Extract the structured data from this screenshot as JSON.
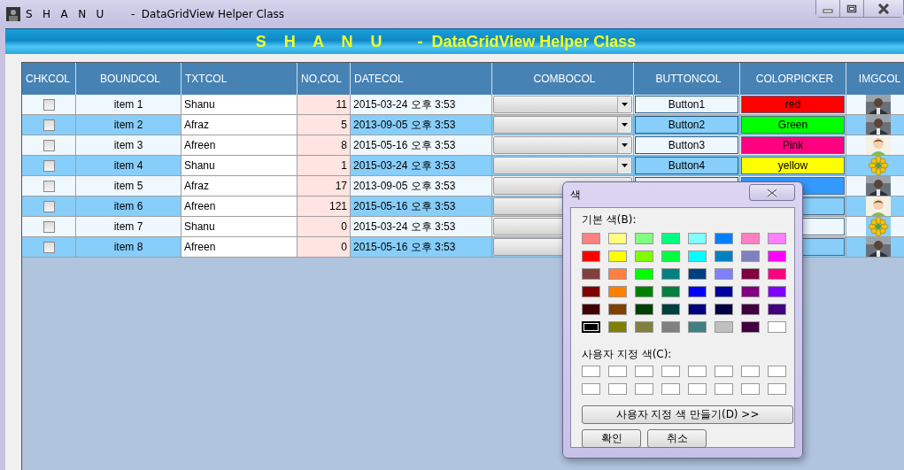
{
  "window": {
    "title": "S   H   A   N   U        -  DataGridView Helper Class"
  },
  "banner": {
    "title": "S    H    A    N    U        -  DataGridView Helper Class"
  },
  "table": {
    "columns": [
      {
        "label": "CHKCOL"
      },
      {
        "label": "BOUNDCOL"
      },
      {
        "label": "TXTCOL"
      },
      {
        "label": "NO,COL"
      },
      {
        "label": "DATECOL"
      },
      {
        "label": "COMBOCOL"
      },
      {
        "label": "BUTTONCOL"
      },
      {
        "label": "COLORPICKER"
      },
      {
        "label": "IMGCOL"
      }
    ],
    "rows": [
      {
        "checked": false,
        "bound": "item 1",
        "text": "Shanu",
        "number": "11",
        "date": "2015-03-24 오후 3:53",
        "combo_arrow": true,
        "button": "Button1",
        "color_label": "red",
        "color": "#ff0000"
      },
      {
        "checked": false,
        "bound": "item 2",
        "text": "Afraz",
        "number": "5",
        "date": "2013-09-05 오후 3:53",
        "combo_arrow": true,
        "button": "Button2",
        "color_label": "Green",
        "color": "#00ff00"
      },
      {
        "checked": false,
        "bound": "item 3",
        "text": "Afreen",
        "number": "8",
        "date": "2015-05-16 오후 3:53",
        "combo_arrow": true,
        "button": "Button3",
        "color_label": "Pink",
        "color": "#ff0080",
        "image": {
          "kind": "avatar"
        }
      },
      {
        "checked": false,
        "bound": "item 4",
        "text": "Shanu",
        "number": "1",
        "date": "2015-03-24 오후 3:53",
        "combo_arrow": true,
        "button": "Button4",
        "color_label": "yellow",
        "color": "#ffff00",
        "image": {
          "kind": "flower"
        }
      },
      {
        "checked": false,
        "bound": "item 5",
        "text": "Afraz",
        "number": "17",
        "date": "2013-09-05 오후 3:53",
        "color": "#3399ff"
      },
      {
        "checked": false,
        "bound": "item 6",
        "text": "Afreen",
        "number": "121",
        "date": "2015-05-16 오후 3:53",
        "image": {
          "kind": "avatar"
        }
      },
      {
        "checked": false,
        "bound": "item 7",
        "text": "Shanu",
        "number": "0",
        "date": "2015-03-24 오후 3:53",
        "image": {
          "kind": "flower"
        }
      },
      {
        "checked": false,
        "bound": "item 8",
        "text": "Afreen",
        "number": "0",
        "date": "2015-05-16 오후 3:53"
      }
    ]
  },
  "color_dialog": {
    "title": "색",
    "basic_label": "기본 색(B):",
    "custom_label": "사용자 지정 색(C):",
    "basic_colors": [
      {
        "color": "#ff8080",
        "selected": false
      },
      {
        "color": "#ffff80",
        "selected": false
      },
      {
        "color": "#80ff80",
        "selected": false
      },
      {
        "color": "#00ff80",
        "selected": false
      },
      {
        "color": "#80ffff",
        "selected": false
      },
      {
        "color": "#0080ff",
        "selected": false
      },
      {
        "color": "#ff80c0",
        "selected": false
      },
      {
        "color": "#ff80ff",
        "selected": false
      },
      {
        "color": "#ff0000",
        "selected": false
      },
      {
        "color": "#ffff00",
        "selected": false
      },
      {
        "color": "#80ff00",
        "selected": false
      },
      {
        "color": "#00ff40",
        "selected": false
      },
      {
        "color": "#00ffff",
        "selected": false
      },
      {
        "color": "#0080c0",
        "selected": false
      },
      {
        "color": "#8080c0",
        "selected": false
      },
      {
        "color": "#ff00ff",
        "selected": false
      },
      {
        "color": "#804040",
        "selected": false
      },
      {
        "color": "#ff8040",
        "selected": false
      },
      {
        "color": "#00ff00",
        "selected": false
      },
      {
        "color": "#008080",
        "selected": false
      },
      {
        "color": "#004080",
        "selected": false
      },
      {
        "color": "#8080ff",
        "selected": false
      },
      {
        "color": "#800040",
        "selected": false
      },
      {
        "color": "#ff0080",
        "selected": false
      },
      {
        "color": "#800000",
        "selected": false
      },
      {
        "color": "#ff8000",
        "selected": false
      },
      {
        "color": "#008000",
        "selected": false
      },
      {
        "color": "#008040",
        "selected": false
      },
      {
        "color": "#0000ff",
        "selected": false
      },
      {
        "color": "#0000a0",
        "selected": false
      },
      {
        "color": "#800080",
        "selected": false
      },
      {
        "color": "#8000ff",
        "selected": false
      },
      {
        "color": "#400000",
        "selected": false
      },
      {
        "color": "#804000",
        "selected": false
      },
      {
        "color": "#004000",
        "selected": false
      },
      {
        "color": "#004040",
        "selected": false
      },
      {
        "color": "#000080",
        "selected": false
      },
      {
        "color": "#000040",
        "selected": false
      },
      {
        "color": "#400040",
        "selected": false
      },
      {
        "color": "#400080",
        "selected": false
      },
      {
        "color": "#000000",
        "selected": true
      },
      {
        "color": "#808000",
        "selected": false
      },
      {
        "color": "#808040",
        "selected": false
      },
      {
        "color": "#808080",
        "selected": false
      },
      {
        "color": "#408080",
        "selected": false
      },
      {
        "color": "#c0c0c0",
        "selected": false
      },
      {
        "color": "#400040",
        "selected": false
      },
      {
        "color": "#ffffff",
        "selected": false
      }
    ],
    "custom_colors": [
      {
        "color": "#ffffff",
        "selected": false
      },
      {
        "color": "#ffffff",
        "selected": false
      },
      {
        "color": "#ffffff",
        "selected": false
      },
      {
        "color": "#ffffff",
        "selected": false
      },
      {
        "color": "#ffffff",
        "selected": false
      },
      {
        "color": "#ffffff",
        "selected": false
      },
      {
        "color": "#ffffff",
        "selected": false
      },
      {
        "color": "#ffffff",
        "selected": false
      },
      {
        "color": "#ffffff",
        "selected": false
      },
      {
        "color": "#ffffff",
        "selected": false
      },
      {
        "color": "#ffffff",
        "selected": false
      },
      {
        "color": "#ffffff",
        "selected": false
      },
      {
        "color": "#ffffff",
        "selected": false
      },
      {
        "color": "#ffffff",
        "selected": false
      },
      {
        "color": "#ffffff",
        "selected": false
      },
      {
        "color": "#ffffff",
        "selected": false
      }
    ],
    "define_button": "사용자 지정 색 만들기(D) >>",
    "ok_button": "확인",
    "cancel_button": "취소"
  }
}
